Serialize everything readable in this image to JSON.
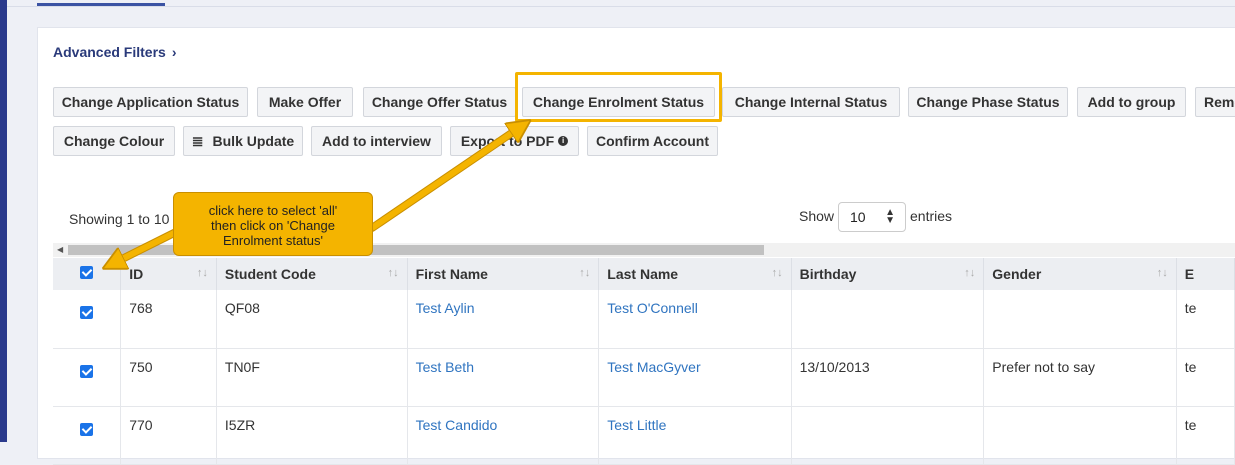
{
  "filters": {
    "advanced_label": "Advanced Filters"
  },
  "actions": {
    "row1": [
      "Change Application Status",
      "Make Offer",
      "Change Offer Status",
      "Change Enrolment Status",
      "Change Internal Status",
      "Change Phase Status",
      "Add to group",
      "Remo"
    ],
    "row2": {
      "change_colour": "Change Colour",
      "bulk_update": "Bulk Update",
      "add_to_interview": "Add to interview",
      "export_pdf": "Export to PDF",
      "confirm_account": "Confirm Account"
    }
  },
  "table_info": {
    "showing": "Showing 1 to 10",
    "show_label": "Show",
    "page_size": "10",
    "entries_label": "entries"
  },
  "callout": {
    "line1": "click here to select 'all'",
    "line2": "then click on 'Change",
    "line3": "Enrolment status'"
  },
  "columns": [
    "ID",
    "Student Code",
    "First Name",
    "Last Name",
    "Birthday",
    "Gender",
    "E"
  ],
  "rows": [
    {
      "id": "768",
      "code": "QF08",
      "first": "Test Aylin",
      "last": "Test O'Connell",
      "birthday": "",
      "gender": "",
      "e": "te"
    },
    {
      "id": "750",
      "code": "TN0F",
      "first": "Test Beth",
      "last": "Test MacGyver",
      "birthday": "13/10/2013",
      "gender": "Prefer not to say",
      "e": "te"
    },
    {
      "id": "770",
      "code": "I5ZR",
      "first": "Test Candido",
      "last": "Test Little",
      "birthday": "",
      "gender": "",
      "e": "te"
    }
  ],
  "colors": {
    "accent": "#f4b400",
    "link": "#2f74c0",
    "sidebar": "#2a3a8c"
  }
}
